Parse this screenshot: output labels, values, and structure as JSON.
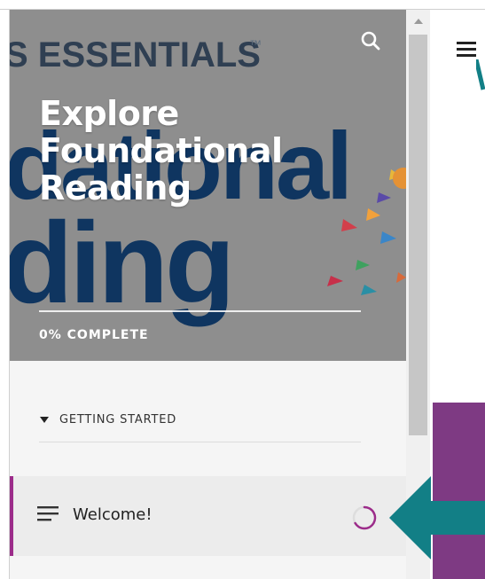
{
  "hero": {
    "brand_text": "S ESSENTIALS",
    "brand_tm": "™",
    "bg_word_1": "dational",
    "bg_word_2": "ding",
    "title_lines": [
      "Explore",
      "Foundational",
      "Reading"
    ],
    "progress_label": "0% COMPLETE",
    "progress_fraction": 0,
    "search_icon": "search-icon"
  },
  "course": {
    "section_label": "GETTING STARTED",
    "section_icon": "caret-down-icon",
    "lessons": [
      {
        "label": "Welcome!",
        "icon": "text-lines-icon",
        "status_icon": "loading-spinner-icon"
      }
    ]
  },
  "main": {
    "menu_icon": "hamburger-menu-icon"
  },
  "colors": {
    "accent_purple": "#9c2c8a",
    "panel_purple": "#7e3a83",
    "arrow_teal": "#127f86",
    "hero_gray": "#8e8e8e",
    "brand_navy": "#10375f"
  }
}
